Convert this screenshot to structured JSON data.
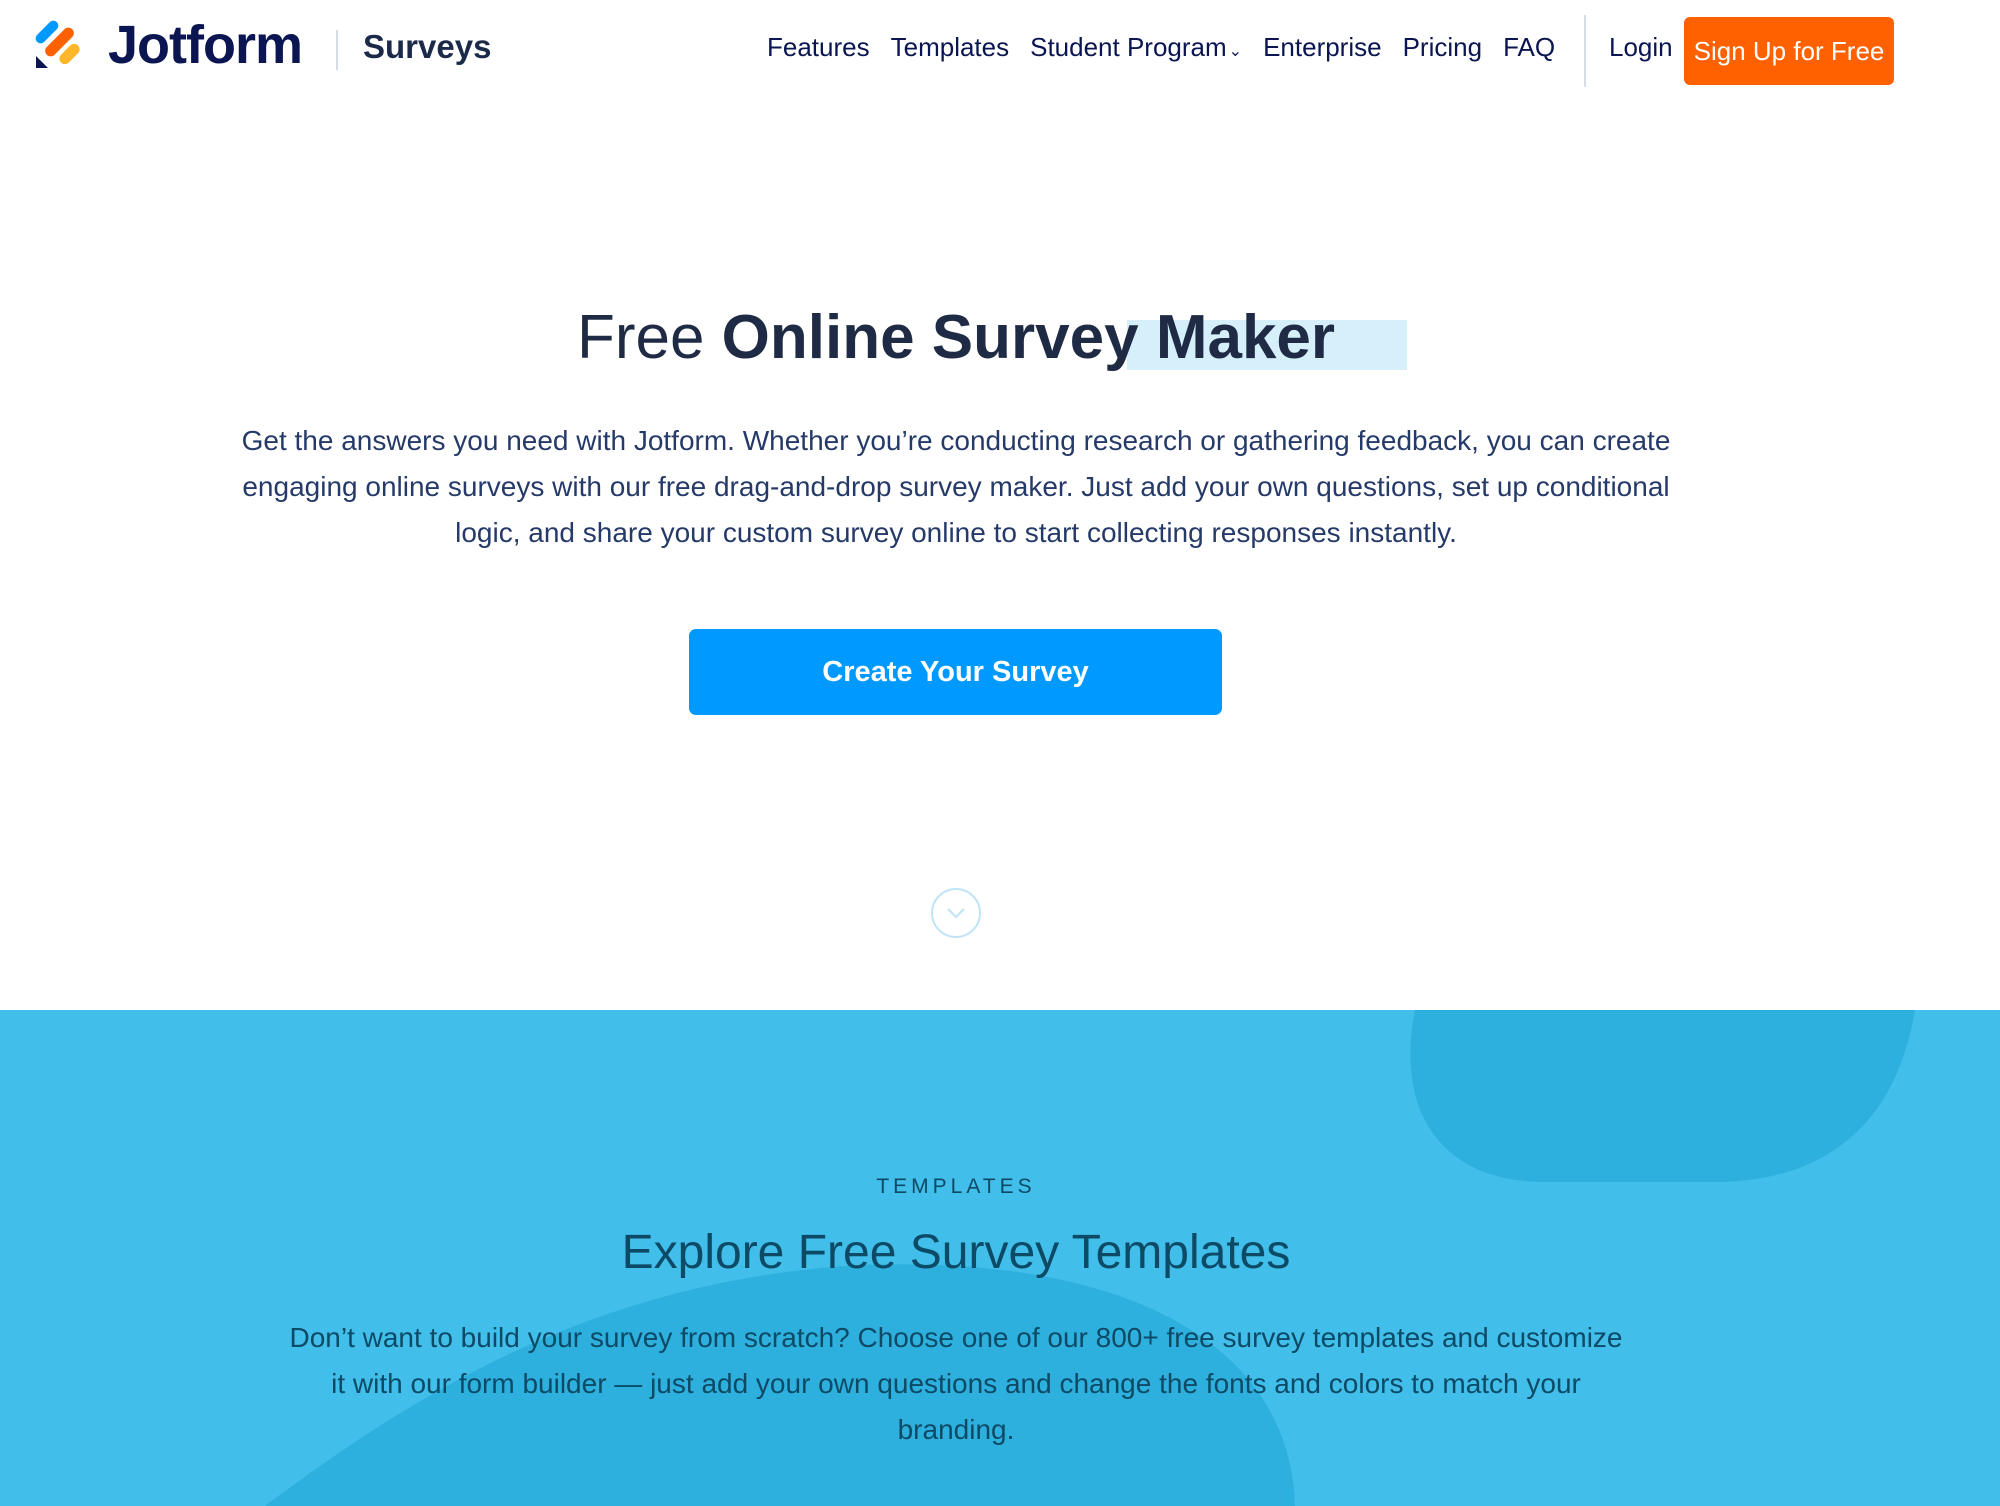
{
  "header": {
    "brand": "Jotform",
    "product": "Surveys",
    "logo_colors": [
      "#0099ff",
      "#ff6100",
      "#ffb629",
      "#0a1551"
    ],
    "nav": [
      {
        "label": "Features"
      },
      {
        "label": "Templates"
      },
      {
        "label": "Student Program",
        "has_dropdown": true
      },
      {
        "label": "Enterprise"
      },
      {
        "label": "Pricing"
      },
      {
        "label": "FAQ"
      }
    ],
    "dropdown_icon": "chevron-down-icon",
    "login_label": "Login",
    "signup_label": "Sign Up for Free",
    "signup_color": "#ff6100"
  },
  "hero": {
    "title_light": "Free",
    "title_bold": "Online Survey Maker",
    "description": "Get the answers you need with Jotform. Whether you’re conducting research or gathering feedback, you can create engaging online surveys with our free drag-and-drop survey maker. Just add your own questions, set up conditional logic, and share your custom survey online to start collecting responses instantly.",
    "cta_label": "Create Your Survey",
    "cta_color": "#0099ff",
    "scroll_icon": "chevron-down-circle-icon"
  },
  "templates_section": {
    "eyebrow": "TEMPLATES",
    "title": "Explore Free Survey Templates",
    "description": "Don’t want to build your survey from scratch? Choose one of our 800+ free survey templates and customize it with our form builder — just add your own questions and change the fonts and colors to match your branding.",
    "background_color": "#41beea"
  }
}
